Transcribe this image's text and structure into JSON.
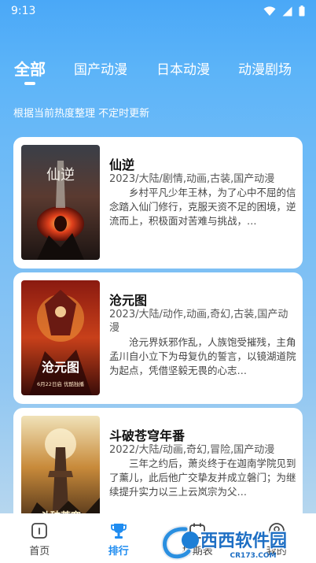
{
  "status": {
    "time": "9:13"
  },
  "tabs": [
    {
      "label": "全部"
    },
    {
      "label": "国产动漫"
    },
    {
      "label": "日本动漫"
    },
    {
      "label": "动漫剧场"
    }
  ],
  "subtitle": "根据当前热度整理 不定时更新",
  "cards": [
    {
      "title": "仙逆",
      "tags": "2023/大陆/剧情,动画,古装,国产动漫",
      "desc": "乡村平凡少年王林，为了心中不屈的信念踏入仙门修行，克服天资不足的困境，逆流而上，积极面对苦难与挑战，…",
      "poster_text": "仙逆"
    },
    {
      "title": "沧元图",
      "tags": "2023/大陆/动作,动画,奇幻,古装,国产动漫",
      "desc": "沧元界妖邪作乱，人族饱受摧残，主角孟川自小立下为母复仇的誓言，以镜湖道院为起点，凭借坚毅无畏的心志…",
      "poster_text": "沧元图",
      "poster_caption": "6月22日启 优酷独播"
    },
    {
      "title": "斗破苍穹年番",
      "tags": "2022/大陆/动画,奇幻,冒险,国产动漫",
      "desc": "三年之约后，萧炎终于在迦南学院见到了薰儿，此后他广交挚友并成立磐门；为继续提升实力以三上云岚宗为父…",
      "poster_text": "斗破苍穹"
    }
  ],
  "nav": [
    {
      "label": "首页",
      "icon": "home-icon"
    },
    {
      "label": "排行",
      "icon": "trophy-icon"
    },
    {
      "label": "排期表",
      "icon": "calendar-icon"
    },
    {
      "label": "我的",
      "icon": "user-icon"
    }
  ],
  "watermark": {
    "text": "西西软件园",
    "url_text": "CR173.COM"
  },
  "colors": {
    "accent": "#1f8cf0",
    "background_top": "#4aa8f7"
  }
}
